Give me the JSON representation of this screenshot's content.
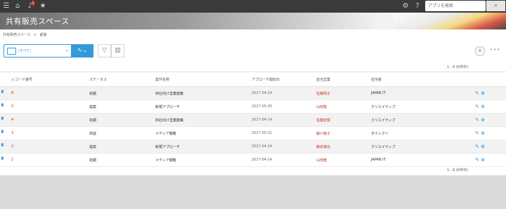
{
  "topbar": {
    "menu_icon": "menu-icon",
    "home_icon": "home-icon",
    "notification_count": "1",
    "search_placeholder": "アプリを検索"
  },
  "space": {
    "title": "共有販売スペース"
  },
  "breadcrumb": {
    "space": "共有販売スペース",
    "separator": ">",
    "app": "顧客"
  },
  "view": {
    "selected": "(すべて)"
  },
  "pager": {
    "top": "1 - 6  (6件中)",
    "bottom": "1 - 6  (6件中)"
  },
  "table": {
    "headers": [
      "レコード番号",
      "ステータス",
      "案件名称",
      "アプローチ開始日",
      "担当営業",
      "担当者"
    ],
    "rows": [
      {
        "id": "6",
        "status": "初期",
        "name": "商社向け営業施策",
        "date": "2017-04-14",
        "sales": "佐藤明子",
        "owner": "JAPAN IT"
      },
      {
        "id": "5",
        "status": "提案",
        "name": "新規アプローチ",
        "date": "2017-05-30",
        "sales": "山田隆",
        "owner": "クリエイティブ"
      },
      {
        "id": "4",
        "status": "初期",
        "name": "商社向け営業施策",
        "date": "2017-04-14",
        "sales": "佐藤宏樹",
        "owner": "クリエイティブ"
      },
      {
        "id": "3",
        "status": "商談",
        "name": "メディア戦略",
        "date": "2017-05-21",
        "sales": "藤川裕子",
        "owner": "ダイレクト"
      },
      {
        "id": "2",
        "status": "提案",
        "name": "新規アプローチ",
        "date": "2017-04-14",
        "sales": "藤本慎也",
        "owner": "クリエイティブ"
      },
      {
        "id": "1",
        "status": "初期",
        "name": "メディア戦略",
        "date": "2017-04-14",
        "sales": "山田隆",
        "owner": "JAPAN IT"
      }
    ]
  },
  "colors": {
    "accent": "#3498db",
    "topbar": "#3a3a3a",
    "record_number": "#d02020"
  }
}
